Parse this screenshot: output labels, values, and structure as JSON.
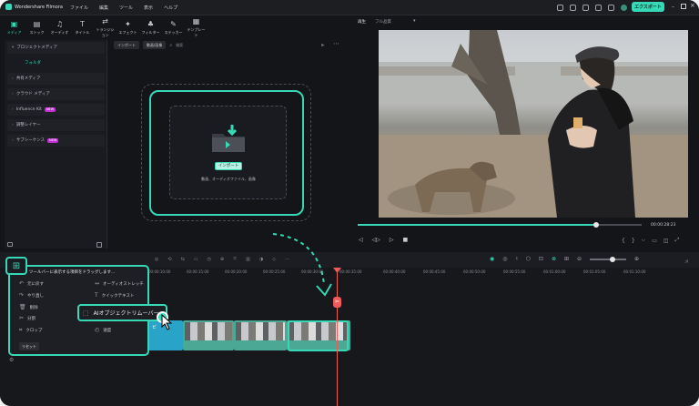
{
  "titlebar": {
    "app_title": "Wondershare Filmora",
    "menu": [
      "ファイル",
      "編集",
      "ツール",
      "表示",
      "ヘルプ"
    ],
    "export_label": "エクスポート"
  },
  "toolbar": {
    "tabs": [
      {
        "label": "メディア",
        "icon": "media-icon"
      },
      {
        "label": "ストック",
        "icon": "stock-icon"
      },
      {
        "label": "オーディオ",
        "icon": "audio-icon"
      },
      {
        "label": "タイトル",
        "icon": "title-icon"
      },
      {
        "label": "トランジション",
        "icon": "transition-icon"
      },
      {
        "label": "エフェクト",
        "icon": "effect-icon"
      },
      {
        "label": "フィルター",
        "icon": "filter-icon"
      },
      {
        "label": "ステッカー",
        "icon": "sticker-icon"
      },
      {
        "label": "テンプレート",
        "icon": "template-icon"
      }
    ]
  },
  "left_panel": {
    "project_media": "プロジェクトメディア",
    "folder": "フォルダ",
    "items": [
      "共有メディア",
      "クラウド メディア",
      "Influence Kit",
      "調整レイヤー",
      "サブシーケンス"
    ],
    "new_badge": "NEW"
  },
  "media": {
    "import_label": "インポート",
    "filter_label": "動画/画像",
    "search_placeholder": "検索",
    "drop_button": "インポート",
    "drop_desc": "動画、オーディオファイル、画像"
  },
  "preview": {
    "playback_label": "再生",
    "quality_label": "フル品質",
    "timecode": "00:00:28:23",
    "progress": 0.84
  },
  "timeline": {
    "ticks": [
      "00:00:10:00",
      "00:00:15:00",
      "00:00:20:00",
      "00:00:25:00",
      "00:00:30:00",
      "00:00:35:00",
      "00:00:40:00",
      "00:00:45:00",
      "00:00:50:00",
      "00:00:55:00",
      "00:01:00:00",
      "00:01:05:00",
      "00:01:10:00"
    ],
    "clip_label": "ビ"
  },
  "popup": {
    "header": "ツールバーに表示する項目をドラッグします...",
    "items_left": [
      "元に戻す",
      "やり直し",
      "削除",
      "分割",
      "クロップ"
    ],
    "items_right": [
      "オーディオストレッチ",
      "クイックテキスト"
    ],
    "highlight_item": "AIオブジェクトリムーバー",
    "extra_item": "速度",
    "reset_label": "リセット"
  },
  "colors": {
    "accent": "#37d8b5",
    "playhead": "#f05a5a",
    "background": "#141519"
  }
}
